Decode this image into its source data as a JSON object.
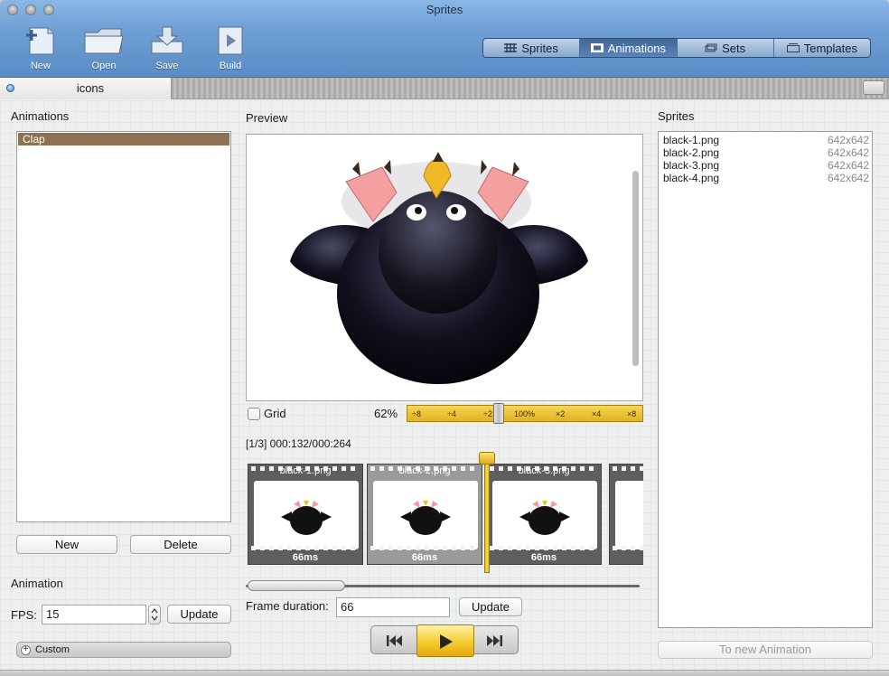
{
  "window": {
    "title": "Sprites"
  },
  "toolbar": {
    "tools": [
      {
        "id": "new",
        "label": "New",
        "icon": "new-document-icon"
      },
      {
        "id": "open",
        "label": "Open",
        "icon": "folder-icon"
      },
      {
        "id": "save",
        "label": "Save",
        "icon": "save-tray-icon"
      },
      {
        "id": "build",
        "label": "Build",
        "icon": "build-play-icon"
      }
    ],
    "views": [
      {
        "label": "Sprites",
        "icon": "grid-icon"
      },
      {
        "label": "Animations",
        "icon": "filmstrip-icon",
        "active": true
      },
      {
        "label": "Sets",
        "icon": "layers-icon"
      },
      {
        "label": "Templates",
        "icon": "template-icon"
      }
    ]
  },
  "tabs": {
    "current": "icons"
  },
  "animations": {
    "title": "Animations",
    "items": [
      "Clap"
    ],
    "new_label": "New",
    "delete_label": "Delete"
  },
  "animation": {
    "title": "Animation",
    "fps_label": "FPS:",
    "fps_value": "15",
    "update_label": "Update",
    "custom_label": "Custom"
  },
  "preview": {
    "title": "Preview",
    "grid_label": "Grid",
    "zoom": "62%",
    "zoom_ticks": [
      "÷8",
      "÷4",
      "÷2",
      "100%",
      "×2",
      "×4",
      "×8"
    ],
    "zoom_level": 0.38
  },
  "timeline": {
    "position": "[1/3] 000:132/000:264",
    "frames": [
      {
        "name": "black-1.png",
        "duration": "66ms"
      },
      {
        "name": "black-2.png",
        "duration": "66ms",
        "selected": true
      },
      {
        "name": "black-3.png",
        "duration": "66ms"
      }
    ],
    "frame_duration_label": "Frame duration:",
    "frame_duration_value": "66",
    "update_label": "Update"
  },
  "sprites": {
    "title": "Sprites",
    "items": [
      {
        "name": "black-1.png",
        "size": "642x642"
      },
      {
        "name": "black-2.png",
        "size": "642x642"
      },
      {
        "name": "black-3.png",
        "size": "642x642"
      },
      {
        "name": "black-4.png",
        "size": "642x642"
      }
    ],
    "to_new_animation_label": "To new Animation"
  },
  "colors": {
    "accent": "#e8c02c",
    "selection": "#8e7150",
    "toolbar": "#6e9fd4"
  }
}
